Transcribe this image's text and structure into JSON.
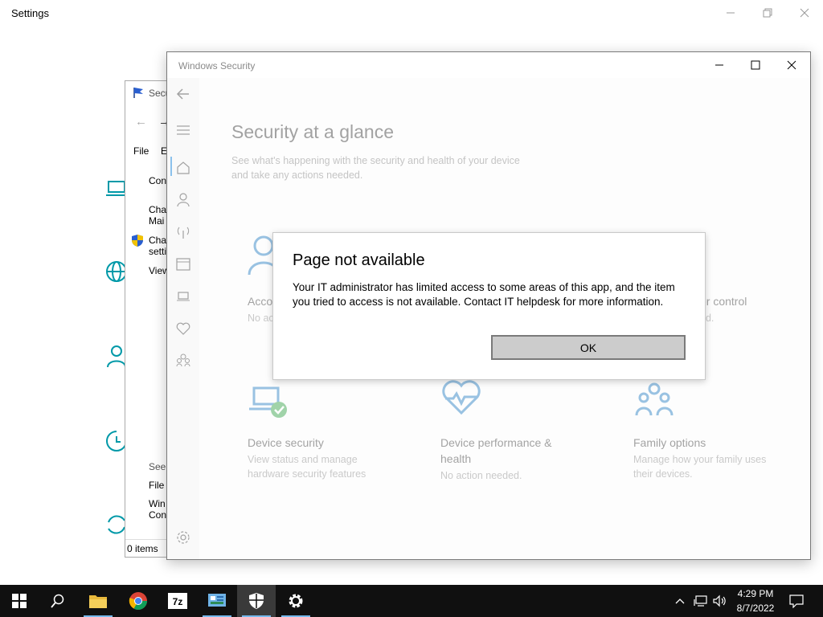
{
  "settings": {
    "title": "Settings"
  },
  "control_panel": {
    "title_partial": "Secu",
    "menu_file": "File",
    "menu_edit_partial": "E",
    "link_con": "Con",
    "link_cha1_line1": "Cha",
    "link_cha1_line2": "Mai",
    "link_cha2_line1": "Cha",
    "link_cha2_line2": "setti",
    "link_view": "View",
    "see_also": "See",
    "link_file": "File",
    "link_win_line1": "Win",
    "link_win_line2": "Con",
    "status_items": "0 items"
  },
  "windows_security": {
    "title": "Windows Security",
    "heading": "Security at a glance",
    "subtitle_line1": "See what's happening with the security and health of your device",
    "subtitle_line2": "and take any actions needed.",
    "tiles": {
      "account": {
        "title_partial": "Acco",
        "desc_partial": "No ac"
      },
      "firewall": {
        "title_partial": "er control",
        "desc_partial": "ed."
      },
      "device_security": {
        "title": "Device security",
        "desc_line1": "View status and manage",
        "desc_line2": "hardware security features"
      },
      "device_performance": {
        "title_line1": "Device performance &",
        "title_line2": "health",
        "desc": "No action needed."
      },
      "family": {
        "title": "Family options",
        "desc_line1": "Manage how your family uses",
        "desc_line2": "their devices."
      }
    }
  },
  "dialog": {
    "title": "Page not available",
    "message": "Your IT administrator has limited access to some areas of this app, and the item you tried to access is not available. Contact IT helpdesk for more information.",
    "ok_label": "OK"
  },
  "taskbar": {
    "clock_time": "4:29 PM",
    "clock_date": "8/7/2022",
    "apps": [
      "start-icon",
      "search-icon",
      "file-explorer-icon",
      "chrome-icon",
      "7zip-icon",
      "control-panel-icon",
      "windows-security-icon",
      "settings-gear-icon"
    ]
  },
  "colors": {
    "accent_teal": "#0099a8",
    "taskbar_bg": "#101010",
    "active_underline": "#76b9ed",
    "tile_icon_blue": "#5aa0d6",
    "check_green": "#2ea043"
  }
}
